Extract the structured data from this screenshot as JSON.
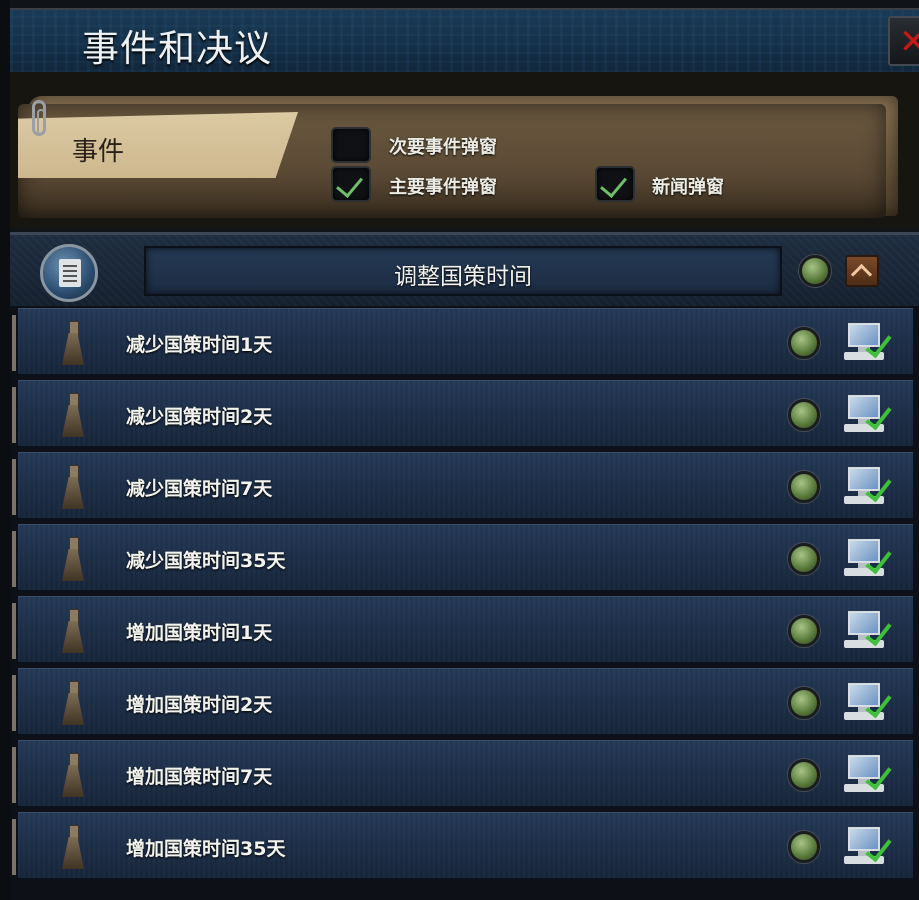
{
  "window": {
    "title": "事件和决议",
    "close_label": "✕"
  },
  "events_panel": {
    "tab_label": "事件",
    "options": [
      {
        "label": "次要事件弹窗",
        "checked": false
      },
      {
        "label": "主要事件弹窗",
        "checked": true
      },
      {
        "label": "新闻弹窗",
        "checked": true
      }
    ]
  },
  "decision_category": {
    "title": "调整国策时间",
    "icon": "notepad-icon"
  },
  "decisions": [
    {
      "label": "减少国策时间1天"
    },
    {
      "label": "减少国策时间2天"
    },
    {
      "label": "减少国策时间7天"
    },
    {
      "label": "减少国策时间35天"
    },
    {
      "label": "增加国策时间1天"
    },
    {
      "label": "增加国策时间2天"
    },
    {
      "label": "增加国策时间7天"
    },
    {
      "label": "增加国策时间35天"
    }
  ],
  "colors": {
    "status_dot": "#5d7e3e",
    "check": "#6fc06a",
    "close": "#c81818"
  }
}
